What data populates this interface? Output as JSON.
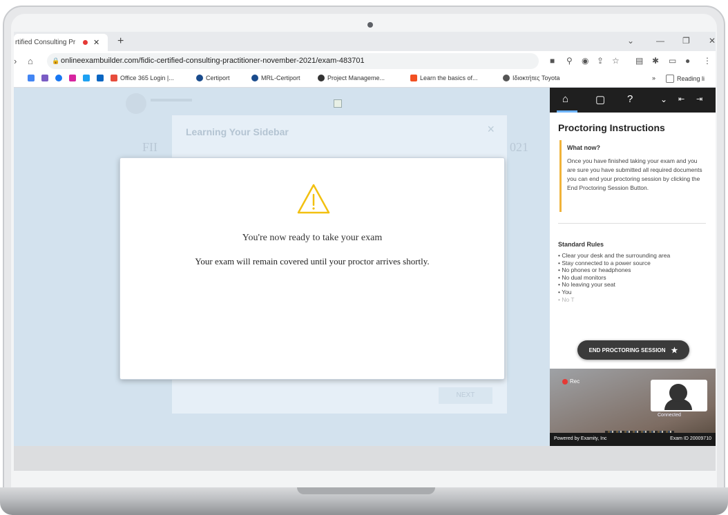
{
  "browser": {
    "tab_title": "rtified Consulting Pr",
    "tab_close": "✕",
    "new_tab": "+",
    "url": "onlineexambuilder.com/fidic-certified-consulting-practitioner-november-2021/exam-483701",
    "bookmarks": [
      {
        "label": "Office 365 Login |...",
        "color": "#e74c3c"
      },
      {
        "label": "Certiport",
        "color": "#1a4b8c"
      },
      {
        "label": "MRL-Certiport",
        "color": "#1a4b8c"
      },
      {
        "label": "Project Manageme...",
        "color": "#333333"
      },
      {
        "label": "Learn the basics of...",
        "color": "#f25022"
      },
      {
        "label": "Ιδιοκτήτες Toyota",
        "color": "#555555"
      }
    ],
    "reading_list": "Reading li"
  },
  "background_page": {
    "card_title": "Learning Your Sidebar",
    "next_label": "NEXT",
    "year_text": "021",
    "fi_text": "FII"
  },
  "modal": {
    "title": "You're now ready to take your exam",
    "message": "Your exam will remain covered until your proctor arrives shortly.",
    "icon": "warning-icon",
    "icon_color": "#f2c010"
  },
  "sidebar": {
    "title": "Proctoring Instructions",
    "what_now_heading": "What now?",
    "what_now_text": "Once you have finished taking your exam and you are sure you have submitted all required documents you can end your proctoring session by clicking the End Proctoring Session Button.",
    "rules_heading": "Standard Rules",
    "rules": [
      "Clear your desk and the surrounding area",
      "Stay connected to a power source",
      "No phones or headphones",
      "No dual monitors",
      "No leaving your seat",
      "You",
      "No T"
    ],
    "end_button": "END PROCTORING SESSION",
    "rec_label": "Rec",
    "connected_label": "Connected",
    "powered_by": "Powered by Examity, Inc",
    "exam_id": "Exam ID 20009710",
    "accent_color": "#f0b33a"
  }
}
